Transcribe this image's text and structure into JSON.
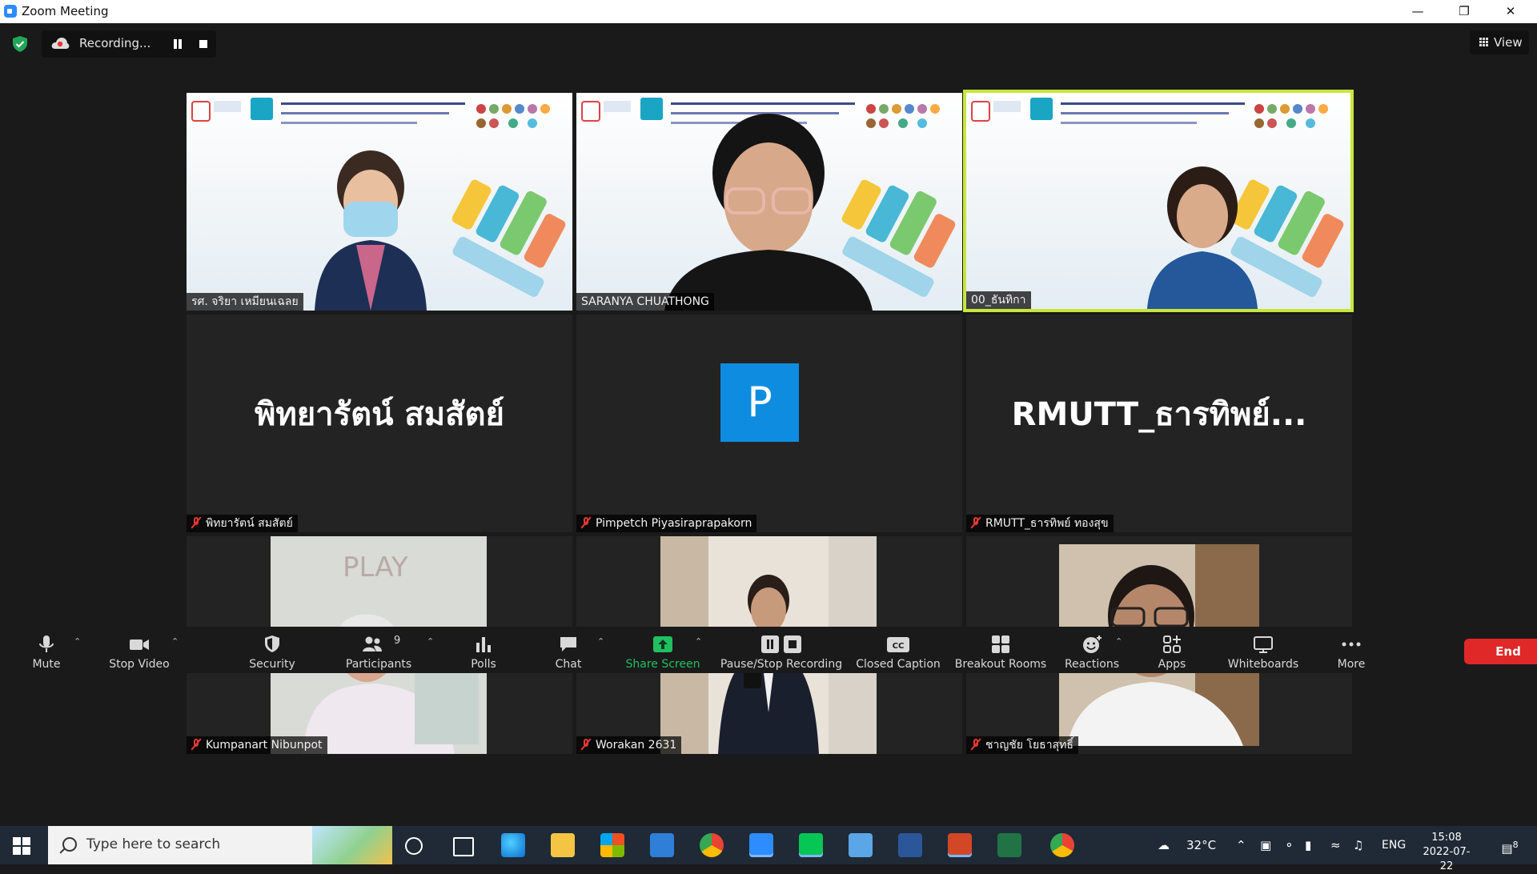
{
  "window": {
    "title": "Zoom Meeting"
  },
  "topbar": {
    "recording_label": "Recording...",
    "view_label": "View"
  },
  "tiles": [
    {
      "name": "รศ. จริยา เหมียนเฉลย",
      "type": "video",
      "muted": false
    },
    {
      "name": "SARANYA CHUATHONG",
      "type": "video",
      "muted": false
    },
    {
      "name": "00_ธันทิกา",
      "type": "video",
      "muted": false,
      "active_speaker": true
    },
    {
      "name": "พิทยารัตน์ สมสัตย์",
      "type": "name",
      "display": "พิทยารัตน์ สมสัตย์",
      "muted": true
    },
    {
      "name": "Pimpetch Piyasiraprapakorn",
      "type": "avatar",
      "display": "P",
      "muted": true
    },
    {
      "name": "RMUTT_ธารทิพย์ ทองสุข",
      "type": "name",
      "display": "RMUTT_ธารทิพย์...",
      "muted": true
    },
    {
      "name": "Kumpanart Nibunpot",
      "type": "video",
      "muted": true
    },
    {
      "name": "Worakan 2631",
      "type": "video",
      "muted": true
    },
    {
      "name": "ชาญชัย โยธาสุทธิ์",
      "type": "video",
      "muted": true
    }
  ],
  "toolbar": {
    "mute": "Mute",
    "stop_video": "Stop Video",
    "security": "Security",
    "participants": "Participants",
    "participants_count": "9",
    "polls": "Polls",
    "chat": "Chat",
    "share_screen": "Share Screen",
    "pause_stop_recording": "Pause/Stop Recording",
    "closed_caption": "Closed Caption",
    "breakout_rooms": "Breakout Rooms",
    "reactions": "Reactions",
    "apps": "Apps",
    "whiteboards": "Whiteboards",
    "more": "More",
    "end": "End",
    "cc_badge": "CC"
  },
  "taskbar": {
    "search_placeholder": "Type here to search",
    "weather": "32°C",
    "language": "ENG",
    "time": "15:08",
    "date": "2022-07-22",
    "notifications": "8"
  },
  "colors": {
    "active_speaker": "#c8e63c",
    "end_button": "#e02828",
    "share_green": "#20c060",
    "avatar_blue": "#0e8de0"
  }
}
